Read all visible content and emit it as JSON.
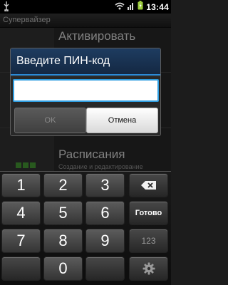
{
  "status_bar": {
    "time": "13:44",
    "icons": [
      "usb-icon",
      "wifi-icon",
      "signal-icon",
      "battery-icon"
    ]
  },
  "app_bar": {
    "title": "Супервайзер"
  },
  "background_list": {
    "items": [
      {
        "title": "Активировать",
        "subtitle": ""
      },
      {
        "title": "Расписания",
        "subtitle": "Создание и редактирование"
      }
    ]
  },
  "dialog": {
    "title": "Введите ПИН-код",
    "input_value": "",
    "ok_label": "OK",
    "cancel_label": "Отмена"
  },
  "keyboard": {
    "keys": [
      "1",
      "2",
      "3",
      "4",
      "5",
      "6",
      "7",
      "8",
      "9",
      "0"
    ],
    "done_label": "Готово",
    "mode_label": "123",
    "backspace_icon": "backspace-icon",
    "settings_icon": "gear-icon"
  },
  "colors": {
    "accent": "#2f9de0",
    "dialog_header": "#1e3c60"
  }
}
